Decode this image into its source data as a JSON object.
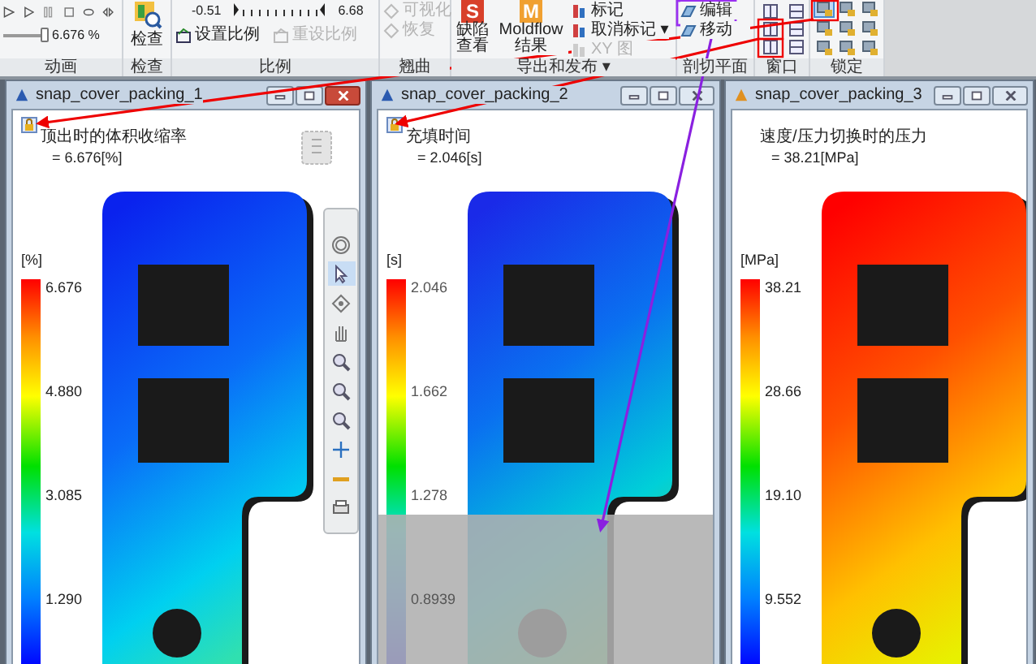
{
  "ribbon": {
    "animation": {
      "label": "动画",
      "slider": {
        "level": 0.93,
        "reading": "6.676 %"
      }
    },
    "check": {
      "label": "检查",
      "button": "检查"
    },
    "scale": {
      "label": "比例",
      "min": "-0.51",
      "max": "6.68",
      "buttons": [
        {
          "label": "设置比例",
          "disabled": false
        },
        {
          "label": "重设比例",
          "disabled": true
        }
      ]
    },
    "warp": {
      "label": "翘曲",
      "buttons": [
        {
          "label": "可视化",
          "disabled": true
        },
        {
          "label": "恢复",
          "disabled": true
        }
      ]
    },
    "export": {
      "label": "导出和发布 ▾",
      "big_buttons": [
        {
          "logo": "S",
          "label": "缺陷查看"
        },
        {
          "logo": "M",
          "label": "Moldflow 结果"
        }
      ],
      "buttons": [
        {
          "label": "标记",
          "disabled": false
        },
        {
          "label": "取消标记 ▾",
          "disabled": false
        },
        {
          "label": "XY 图",
          "disabled": true
        }
      ]
    },
    "section": {
      "label": "剖切平面",
      "buttons": [
        {
          "label": "编辑"
        },
        {
          "label": "移动"
        }
      ]
    },
    "window": {
      "label": "窗口"
    },
    "lock": {
      "label": "锁定",
      "buttons": [
        {
          "selected": true
        },
        {
          "selected": false
        },
        {
          "selected": false
        },
        {
          "selected": false
        },
        {
          "selected": false
        },
        {
          "selected": false
        },
        {
          "selected": false
        },
        {
          "selected": false
        },
        {
          "selected": false
        }
      ]
    }
  },
  "windows": [
    {
      "title": "snap_cover_packing_1",
      "active": true,
      "locked": true,
      "result_name": "顶出时的体积收缩率",
      "result_value": "= 6.676[%]",
      "unit": "[%]",
      "scale_labels": [
        "6.676",
        "4.880",
        "3.085",
        "1.290"
      ],
      "view_cube": true,
      "section_overlay": false,
      "tools": [
        {
          "kind": "orbit",
          "selected": false
        },
        {
          "kind": "select",
          "selected": true
        },
        {
          "kind": "center",
          "selected": false
        },
        {
          "kind": "pan",
          "selected": false
        },
        {
          "kind": "zoom-area",
          "selected": false
        },
        {
          "kind": "zoom",
          "selected": false
        },
        {
          "kind": "zoom-out",
          "selected": false
        },
        {
          "kind": "crosshair",
          "selected": false
        },
        {
          "kind": "ruler",
          "selected": false
        },
        {
          "kind": "print",
          "selected": false
        }
      ]
    },
    {
      "title": "snap_cover_packing_2",
      "active": false,
      "locked": true,
      "result_name": "充填时间",
      "result_value": "= 2.046[s]",
      "unit": "[s]",
      "scale_labels": [
        "2.046",
        "1.662",
        "1.278",
        "0.8939"
      ],
      "view_cube": false,
      "section_overlay": true
    },
    {
      "title": "snap_cover_packing_3",
      "active": false,
      "locked": false,
      "result_name": "速度/压力切换时的压力",
      "result_value": "= 38.21[MPa]",
      "unit": "[MPa]",
      "scale_labels": [
        "38.21",
        "28.66",
        "19.10",
        "9.552"
      ],
      "view_cube": false,
      "section_overlay": false
    }
  ]
}
